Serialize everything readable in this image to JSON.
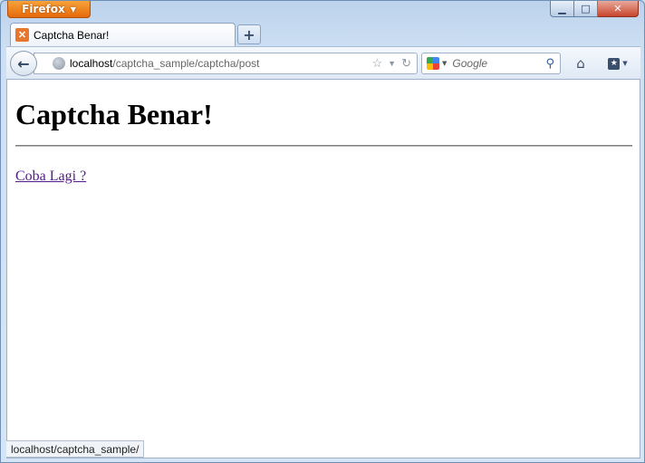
{
  "browser": {
    "menu_button_label": "Firefox",
    "window_controls": {
      "minimize": "▁",
      "maximize": "□",
      "close": "✕"
    }
  },
  "tab": {
    "title": "Captcha Benar!",
    "new_tab_label": "+"
  },
  "address_bar": {
    "host": "localhost",
    "path": "/captcha_sample/captcha/post"
  },
  "search_bar": {
    "placeholder": "Google"
  },
  "page": {
    "heading": "Captcha Benar!",
    "link_text": "Coba Lagi ?"
  },
  "status_bar": {
    "text": "localhost/captcha_sample/"
  }
}
